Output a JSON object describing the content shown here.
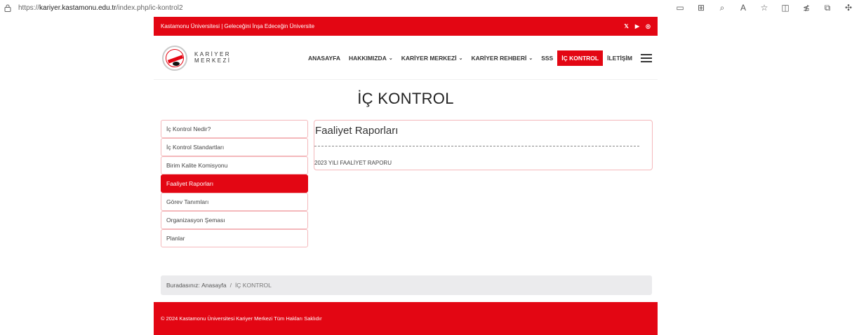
{
  "browser": {
    "url_prefix": "https://",
    "url_host": "kariyer.kastamonu.edu.tr",
    "url_path": "/index.php/ic-kontrol2"
  },
  "topbar": {
    "text": "Kastamonu Üniversitesi | Geleceğini İnşa Edeceğin Üniversite",
    "socials": [
      {
        "icon": "twitter-icon",
        "glyph": "𝕏"
      },
      {
        "icon": "youtube-icon",
        "glyph": "▶"
      },
      {
        "icon": "instagram-icon",
        "glyph": "◎"
      }
    ]
  },
  "logo": {
    "line1": "KARİYER",
    "line2": "MERKEZİ"
  },
  "menu": {
    "items": [
      {
        "label": "ANASAYFA",
        "dropdown": false
      },
      {
        "label": "HAKKIMIZDA",
        "dropdown": true
      },
      {
        "label": "KARİYER MERKEZİ",
        "dropdown": true
      },
      {
        "label": "KARİYER REHBERİ",
        "dropdown": true
      },
      {
        "label": "SSS",
        "dropdown": false
      },
      {
        "label": "İÇ KONTROL",
        "dropdown": false
      },
      {
        "label": "İLETİŞİM",
        "dropdown": false
      }
    ],
    "chevron": "⌄"
  },
  "page": {
    "title": "İÇ KONTROL"
  },
  "sidebar": {
    "items": [
      {
        "label": "İç Kontrol Nedir?"
      },
      {
        "label": "İç Kontrol Standartları"
      },
      {
        "label": "Birim Kalite Komisyonu"
      },
      {
        "label": "Faaliyet Raporları"
      },
      {
        "label": "Görev Tanımları"
      },
      {
        "label": "Organizasyon Şeması"
      },
      {
        "label": "Planlar"
      }
    ],
    "active_index": 3
  },
  "panel": {
    "title": "Faaliyet Raporları",
    "link": "2023 YILI FAALİYET RAPORU"
  },
  "breadcrumb": {
    "prefix": "Buradasınız:",
    "home": "Anasayfa",
    "separator": "/",
    "current": "İÇ KONTROL"
  },
  "footer": {
    "text": "© 2024 Kastamonu Üniversitesi Kariyer Merkezi Tüm Hakları Saklıdır"
  },
  "colors": {
    "brand_red": "#e30613",
    "border_pink": "#f4b8bb"
  }
}
